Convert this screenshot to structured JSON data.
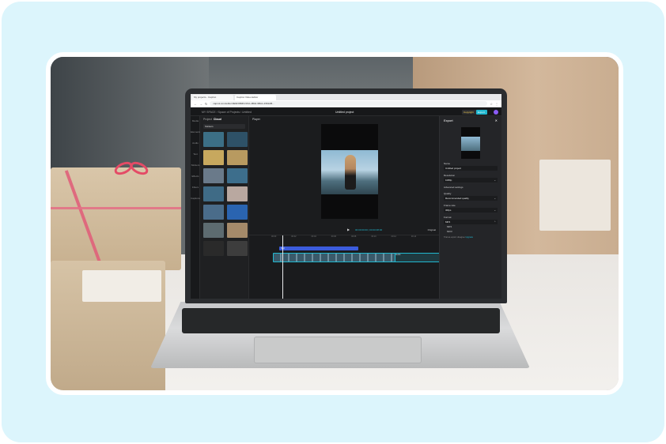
{
  "browser": {
    "tabs": [
      "My projects - CapCut",
      "CapCut Video Editor"
    ],
    "url": "capcut.com/editor/3E9F9B38-F15A-4B42-9BA1-2962AB..."
  },
  "app": {
    "breadcrumb": "MY SPACE / Space of Projects / Untitled",
    "project_title": "Untitled project",
    "copyright_button": "Copyright",
    "export_button": "Export"
  },
  "rail": [
    "Media",
    "Elements",
    "Audio",
    "Text",
    "Stickers",
    "Effects",
    "Filters",
    "Captions"
  ],
  "media": {
    "tabs": {
      "left": "Project",
      "right": "Cloud"
    },
    "filter": "Stickers",
    "thumbs": [
      {
        "label": "rectangle",
        "color": "#3c6f86"
      },
      {
        "label": "rectangle",
        "color": "#2e5167"
      },
      {
        "label": "green screen",
        "color": "#c7a85e"
      },
      {
        "label": "beach sunset",
        "color": "#b89a60"
      },
      {
        "label": "car drive",
        "color": "#6a7a8a"
      },
      {
        "label": "city lake",
        "color": "#3d6e8c"
      },
      {
        "label": "mountain",
        "color": "#3f6b86"
      },
      {
        "label": "portrait",
        "color": "#b9a8a0"
      },
      {
        "label": "road view",
        "color": "#4a6c8a"
      },
      {
        "label": "app screen",
        "color": "#2a64b0"
      },
      {
        "label": "dance clip",
        "color": "#5d6b70"
      },
      {
        "label": "woman pose",
        "color": "#a58a6a"
      },
      {
        "label": "dark pose",
        "color": "#2a2a2a"
      },
      {
        "label": "studio shot",
        "color": "#3d3d3d"
      }
    ]
  },
  "player": {
    "title": "Player",
    "time": "00:00:00:00 | 00:00:08:00",
    "ratio": "Original"
  },
  "timeline": {
    "ruler": [
      "00:00",
      "00:02",
      "00:04",
      "00:06",
      "00:08",
      "00:10",
      "00:12",
      "00:14"
    ],
    "text_track": "Text",
    "main_track": "Clip",
    "audio_track": "Audio"
  },
  "export": {
    "title": "Export",
    "fields": [
      {
        "label": "Name",
        "value": "Untitled project"
      },
      {
        "label": "Resolution",
        "value": "1080p"
      },
      {
        "label": "Quality",
        "value": "Recommended quality"
      },
      {
        "label": "Frame rate",
        "value": "30fps"
      },
      {
        "label": "Format",
        "value": "MP4"
      }
    ],
    "advanced": "Advanced settings",
    "format_options": [
      "MP4",
      "MOV"
    ],
    "note": "Trial as export: disagree",
    "note_link": "Upgrade"
  },
  "colors": {
    "accent": "#22b8cf",
    "frame": "#dcf5fc",
    "avatar": "#8b5cf6"
  }
}
